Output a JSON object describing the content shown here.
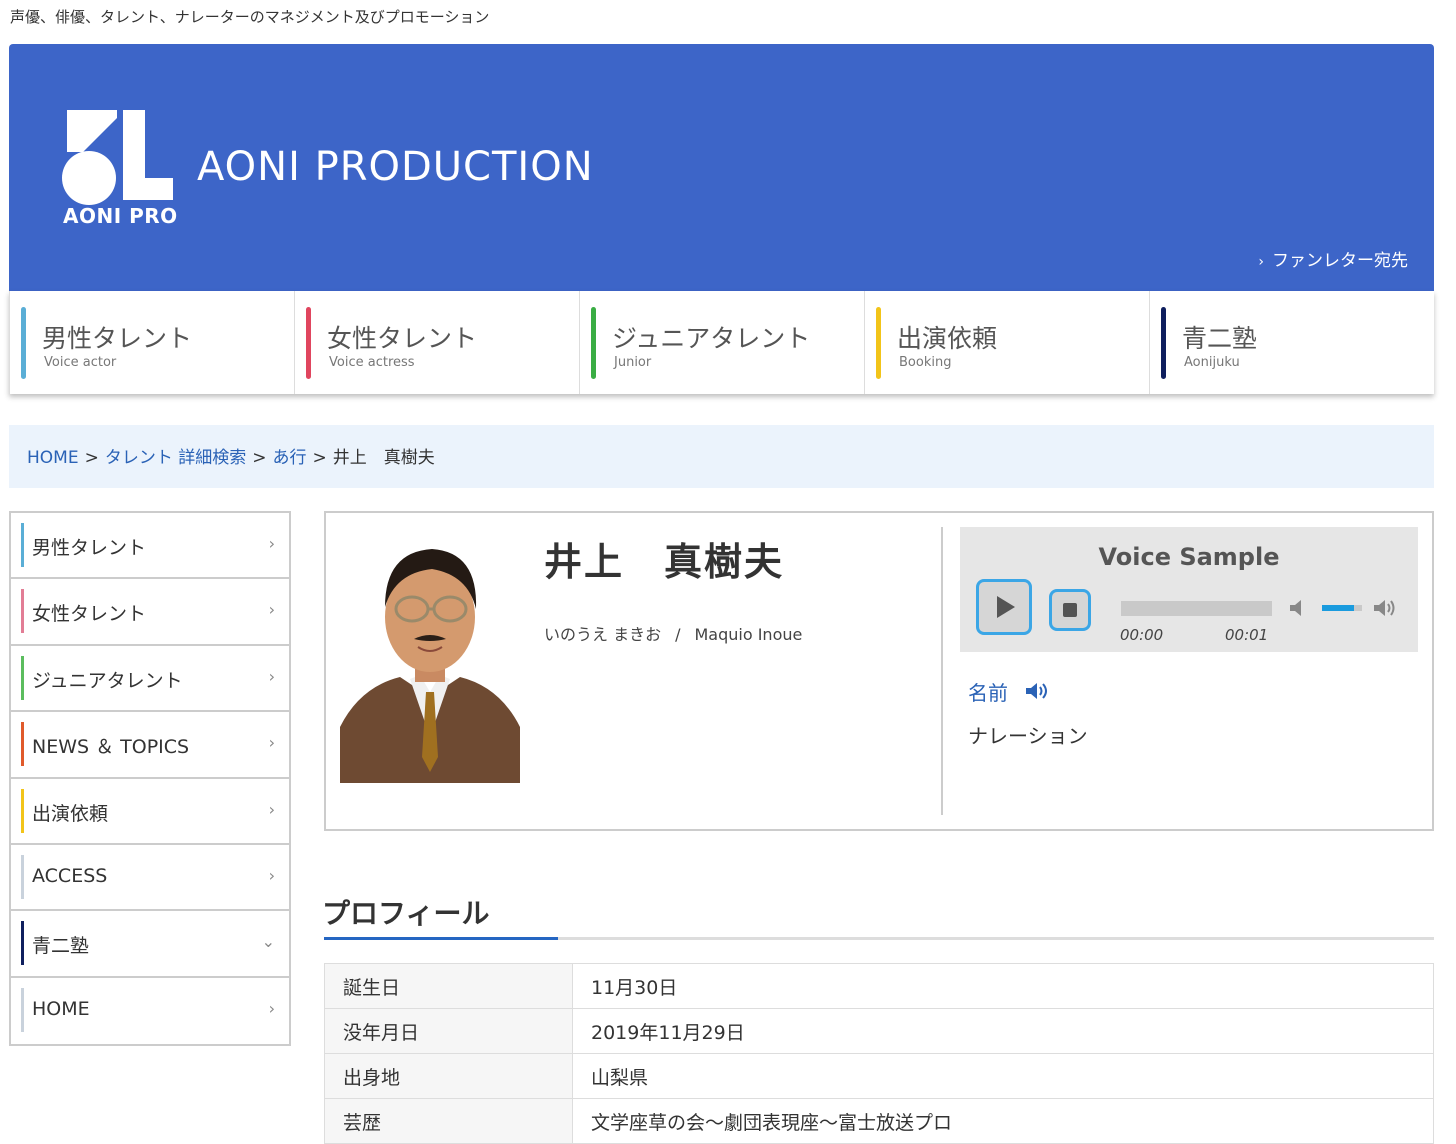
{
  "tagline": "声優、俳優、タレント、ナレーターのマネジメント及びプロモーション",
  "header": {
    "brand": "AONI PRODUCTION",
    "logo_sub": "AONI PRO",
    "fanletter": "ファンレター宛先",
    "bg_color": "#3d65c8"
  },
  "nav": [
    {
      "jp": "男性タレント",
      "en": "Voice actor",
      "color": "#5aaed6"
    },
    {
      "jp": "女性タレント",
      "en": "Voice actress",
      "color": "#e0455e"
    },
    {
      "jp": "ジュニアタレント",
      "en": "Junior",
      "color": "#3aad44"
    },
    {
      "jp": "出演依頼",
      "en": "Booking",
      "color": "#f2c419"
    },
    {
      "jp": "青二塾",
      "en": "Aonijuku",
      "color": "#0f1f5e"
    }
  ],
  "breadcrumb": {
    "home": "HOME",
    "talent": "タレント",
    "search": "詳細検索",
    "row": "あ行",
    "current": "井上　真樹夫",
    "sep": ">"
  },
  "side_menu": [
    {
      "label": "男性タレント",
      "color": "#5aaed6",
      "chevron": "›"
    },
    {
      "label": "女性タレント",
      "color": "#e27d95",
      "chevron": "›"
    },
    {
      "label": "ジュニアタレント",
      "color": "#5bbd5e",
      "chevron": "›"
    },
    {
      "label": "NEWS ＆ TOPICS",
      "color": "#e05a2b",
      "chevron": "›"
    },
    {
      "label": "出演依頼",
      "color": "#f2c419",
      "chevron": "›"
    },
    {
      "label": "ACCESS",
      "color": "#c9d2dc",
      "chevron": "›"
    },
    {
      "label": "青二塾",
      "color": "#0f1f5e",
      "chevron": "⌄"
    },
    {
      "label": "HOME",
      "color": "#c9d2dc",
      "chevron": "›"
    }
  ],
  "talent": {
    "name": "井上　真樹夫",
    "kana": "いのうえ まきお",
    "slash": "/",
    "romaji": "Maquio Inoue"
  },
  "voice_sample": {
    "title": "Voice Sample",
    "current_time": "00:00",
    "duration": "00:01",
    "volume": 0.8,
    "link_label": "名前",
    "description": "ナレーション"
  },
  "profile": {
    "heading": "プロフィール",
    "rows": [
      {
        "key": "誕生日",
        "value": "11月30日"
      },
      {
        "key": "没年月日",
        "value": "2019年11月29日"
      },
      {
        "key": "出身地",
        "value": "山梨県"
      },
      {
        "key": "芸歴",
        "value": "文学座草の会～劇団表現座～富士放送プロ"
      }
    ]
  }
}
